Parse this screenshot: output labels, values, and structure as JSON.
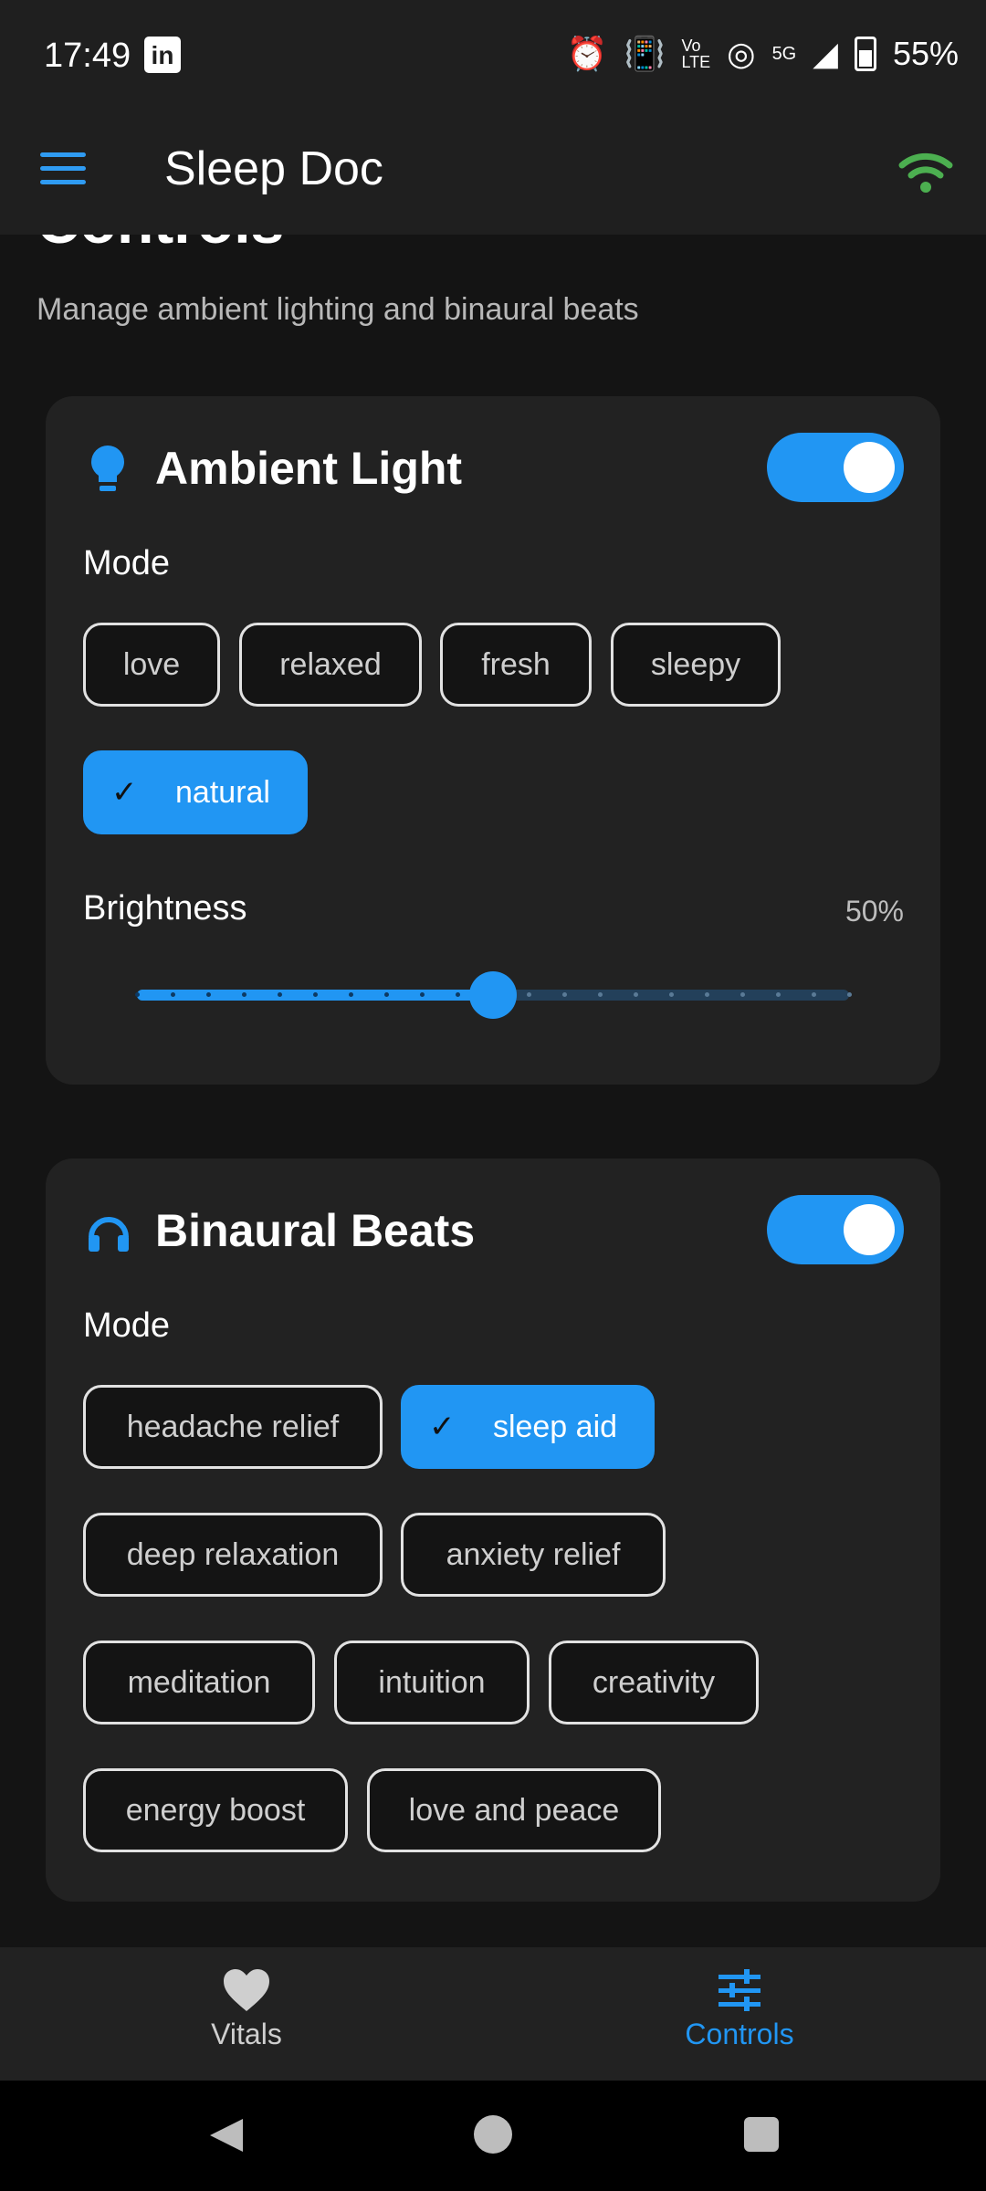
{
  "status_bar": {
    "time": "17:49",
    "app_icon": "linkedin-icon",
    "indicators": [
      "alarm-icon",
      "vibrate-icon",
      "volte-icon",
      "hotspot-icon",
      "5g-signal-icon",
      "battery-icon"
    ],
    "network": "5G",
    "battery": "55%"
  },
  "app_bar": {
    "title": "Sleep Doc",
    "menu_icon": "hamburger-menu-icon",
    "connection_icon": "wifi-icon",
    "connection_color": "#4caf50"
  },
  "page": {
    "title": "Controls",
    "subtitle": "Manage ambient lighting and binaural beats"
  },
  "ambient_light": {
    "title": "Ambient Light",
    "icon": "lightbulb-icon",
    "enabled": true,
    "mode_label": "Mode",
    "modes": [
      "love",
      "relaxed",
      "fresh",
      "sleepy",
      "natural"
    ],
    "selected_mode": "natural",
    "brightness_label": "Brightness",
    "brightness_value": "50%",
    "brightness_level": 0.5
  },
  "binaural_beats": {
    "title": "Binaural Beats",
    "icon": "headphones-icon",
    "enabled": true,
    "mode_label": "Mode",
    "modes": [
      "headache relief",
      "sleep aid",
      "deep relaxation",
      "anxiety relief",
      "meditation",
      "intuition",
      "creativity",
      "energy boost",
      "love and peace"
    ],
    "selected_mode": "sleep aid"
  },
  "bottom_nav": {
    "items": [
      {
        "label": "Vitals",
        "icon": "heart-icon",
        "active": false
      },
      {
        "label": "Controls",
        "icon": "sliders-icon",
        "active": true
      }
    ]
  },
  "colors": {
    "accent": "#2196f3",
    "background": "#141414",
    "card": "#222222",
    "success": "#4caf50"
  }
}
